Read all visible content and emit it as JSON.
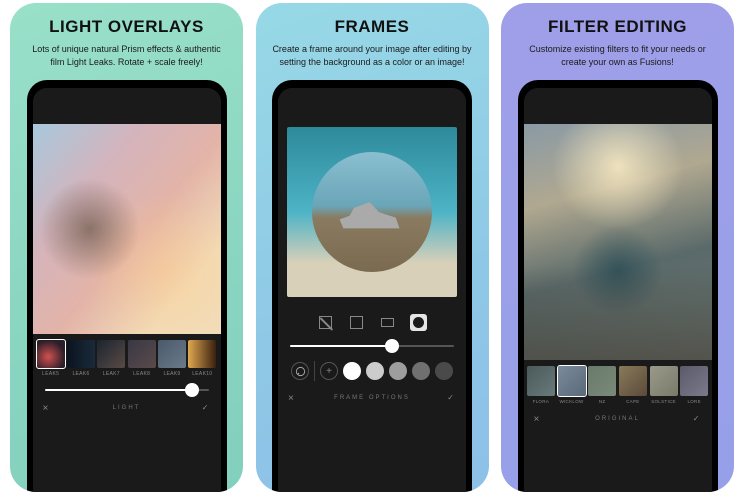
{
  "panels": [
    {
      "title": "LIGHT OVERLAYS",
      "desc": "Lots of unique natural Prism effects & authentic film Light Leaks. Rotate + scale freely!",
      "section": "LIGHT",
      "slider_pct": 90,
      "thumbs": [
        {
          "label": "LEAK5"
        },
        {
          "label": "LEAK6"
        },
        {
          "label": "LEAK7"
        },
        {
          "label": "LEAK8"
        },
        {
          "label": "LEAK9"
        },
        {
          "label": "LEAK10"
        }
      ],
      "selected": 0
    },
    {
      "title": "FRAMES",
      "desc": "Create a frame around your image after editing by setting the background as a color or an image!",
      "section": "FRAME OPTIONS",
      "slider_pct": 62,
      "shapes": [
        "none",
        "square",
        "wide",
        "circle"
      ],
      "shape_selected": 3,
      "swatches": [
        "#ffffff",
        "#cccccc",
        "#9e9e9e",
        "#707070",
        "#4a4a4a"
      ]
    },
    {
      "title": "FILTER EDITING",
      "desc": "Customize existing filters to fit your needs or create your own as Fusions!",
      "section": "ORIGINAL",
      "thumbs": [
        {
          "label": "FLORA"
        },
        {
          "label": "WICKLOW"
        },
        {
          "label": "NZ"
        },
        {
          "label": "CAPE"
        },
        {
          "label": "SOLSTICE"
        },
        {
          "label": "LORE"
        }
      ],
      "selected": 1
    }
  ]
}
